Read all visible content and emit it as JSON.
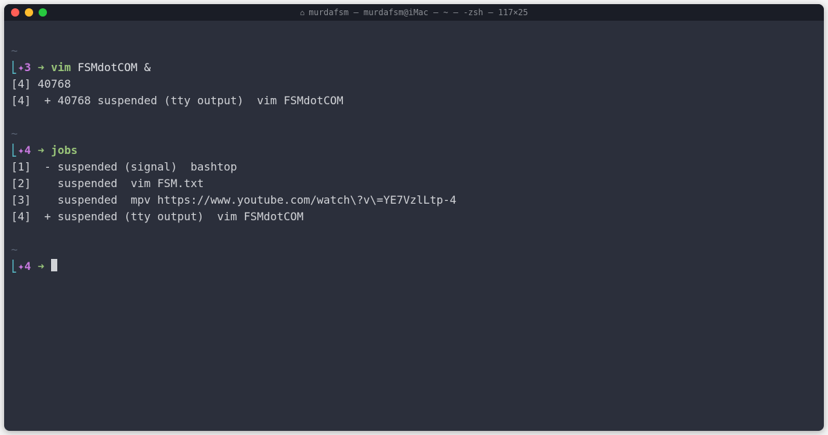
{
  "titlebar": {
    "title": "murdafsm — murdafsm@iMac — ~ — -zsh — 117×25"
  },
  "prompt1": {
    "bracket": "⎣",
    "sparkle": "✦",
    "num": "3",
    "arrow": "➜",
    "cmd": "vim",
    "args": " FSMdotCOM &"
  },
  "output1_line1": "[4] 40768",
  "output1_line2": "[4]  + 40768 suspended (tty output)  vim FSMdotCOM",
  "prompt2": {
    "bracket": "⎣",
    "sparkle": "✦",
    "num": "4",
    "arrow": "➜",
    "cmd": "jobs"
  },
  "jobs": {
    "line1": "[1]  - suspended (signal)  bashtop",
    "line2": "[2]    suspended  vim FSM.txt",
    "line3": "[3]    suspended  mpv https://www.youtube.com/watch\\?v\\=YE7VzlLtp-4",
    "line4": "[4]  + suspended (tty output)  vim FSMdotCOM"
  },
  "prompt3": {
    "bracket": "⎣",
    "sparkle": "✦",
    "num": "4",
    "arrow": "➜"
  },
  "tilde": "~"
}
